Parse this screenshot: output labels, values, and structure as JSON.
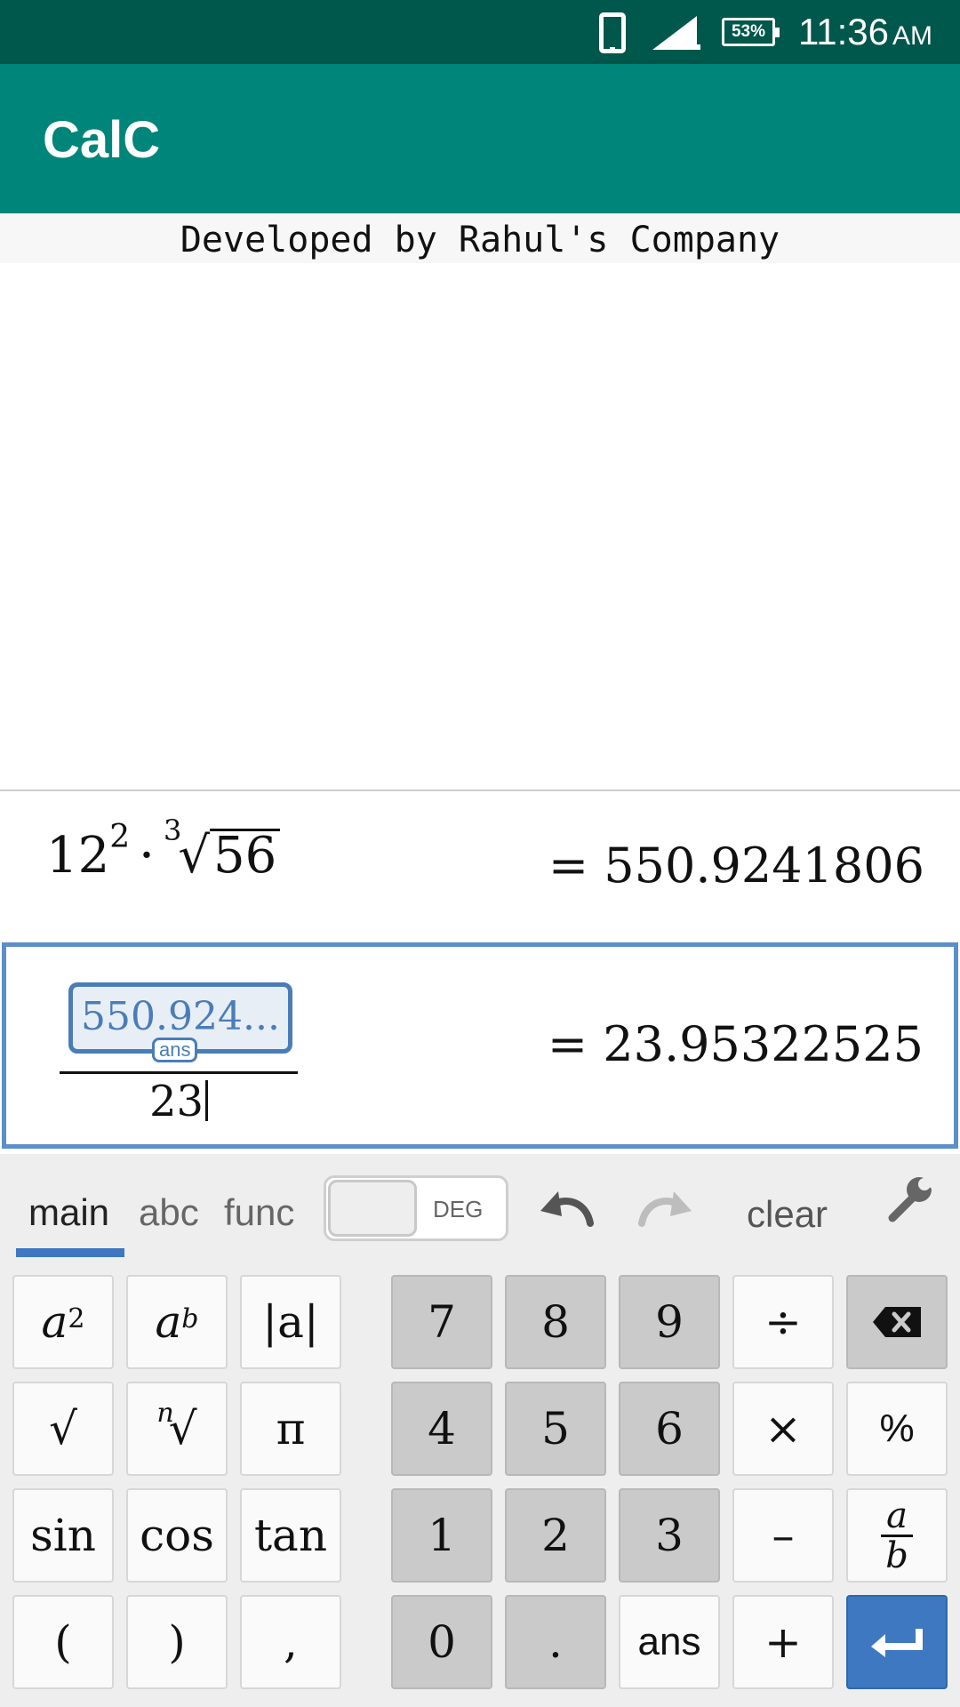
{
  "status_bar": {
    "battery": "53%",
    "time": "11:36",
    "ampm": "AM"
  },
  "app": {
    "title": "CalC",
    "banner": "Developed by Rahul's Company"
  },
  "history": [
    {
      "base": "12",
      "exponent": "2",
      "operator": "·",
      "root_index": "3",
      "radicand": "56",
      "result": "= 550.9241806"
    }
  ],
  "current": {
    "numerator": "550.924...",
    "numerator_tag": "ans",
    "denominator": "23",
    "result": "= 23.95322525"
  },
  "keyboard": {
    "tabs": [
      "main",
      "abc",
      "func"
    ],
    "active_tab": "main",
    "angle_mode": "DEG",
    "clear_label": "clear",
    "keys": {
      "sq": "a",
      "sq_exp": "2",
      "pow": "a",
      "pow_exp": "b",
      "abs": "|a|",
      "sqrt": "√",
      "nroot_n": "n",
      "nroot": "√",
      "pi": "π",
      "sin": "sin",
      "cos": "cos",
      "tan": "tan",
      "lparen": "(",
      "rparen": ")",
      "comma": ",",
      "d7": "7",
      "d8": "8",
      "d9": "9",
      "div": "÷",
      "d4": "4",
      "d5": "5",
      "d6": "6",
      "mul": "×",
      "pct": "%",
      "d1": "1",
      "d2": "2",
      "d3": "3",
      "minus": "–",
      "frac_num": "a",
      "frac_den": "b",
      "d0": "0",
      "dot": ".",
      "ans": "ans",
      "plus": "+"
    }
  },
  "colors": {
    "status_bar": "#00574b",
    "app_bar": "#00857a",
    "accent": "#3d78c0"
  }
}
